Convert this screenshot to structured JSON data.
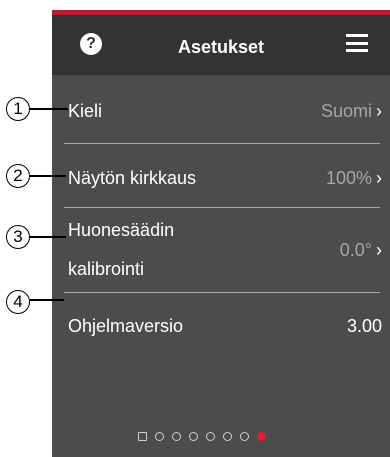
{
  "header": {
    "title": "Asetukset",
    "help_icon": "?",
    "menu_icon": "hamburger-menu-icon"
  },
  "settings": [
    {
      "label": "Kieli",
      "value": "Suomi",
      "chevron": "›"
    },
    {
      "label": "Näytön kirkkaus",
      "value": "100%",
      "chevron": "›"
    },
    {
      "label_line1": "Huonesäädin",
      "label_line2": "kalibrointi",
      "value": "0.0°",
      "chevron": "›"
    },
    {
      "label": "Ohjelmaversio",
      "value": "3.00"
    }
  ],
  "callouts": [
    "1",
    "2",
    "3",
    "4"
  ],
  "pager": {
    "count": 7,
    "active_index": 7
  },
  "colors": {
    "accent": "#b41e2e",
    "header_bg": "#333333",
    "panel_bg": "#4c4c4c",
    "active_dot": "#e0202e"
  }
}
